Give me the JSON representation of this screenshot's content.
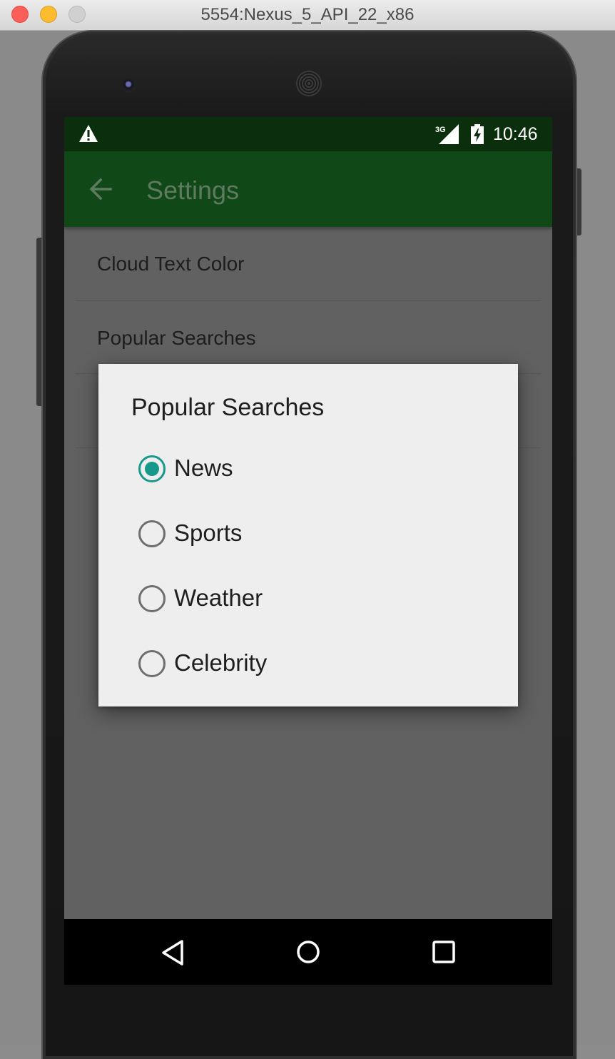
{
  "window": {
    "title": "5554:Nexus_5_API_22_x86"
  },
  "status_bar": {
    "network": "3G",
    "time": "10:46",
    "icons": [
      "warning-icon",
      "signal-icon",
      "battery-charging-icon"
    ]
  },
  "app_bar": {
    "title": "Settings",
    "back_icon": "arrow-back-icon"
  },
  "preferences": [
    {
      "label": "Cloud Text Color"
    },
    {
      "label": "Popular Searches"
    }
  ],
  "dialog": {
    "title": "Popular Searches",
    "options": [
      {
        "label": "News",
        "checked": true
      },
      {
        "label": "Sports",
        "checked": false
      },
      {
        "label": "Weather",
        "checked": false
      },
      {
        "label": "Celebrity",
        "checked": false
      }
    ],
    "accent_color": "#16988a"
  },
  "nav_bar": {
    "icons": [
      "back-triangle-icon",
      "home-circle-icon",
      "recents-square-icon"
    ]
  },
  "colors": {
    "status_bar": "#0b2e0d",
    "app_bar": "#104818",
    "scrim": "#616161",
    "dialog_bg": "#eeeeee"
  }
}
